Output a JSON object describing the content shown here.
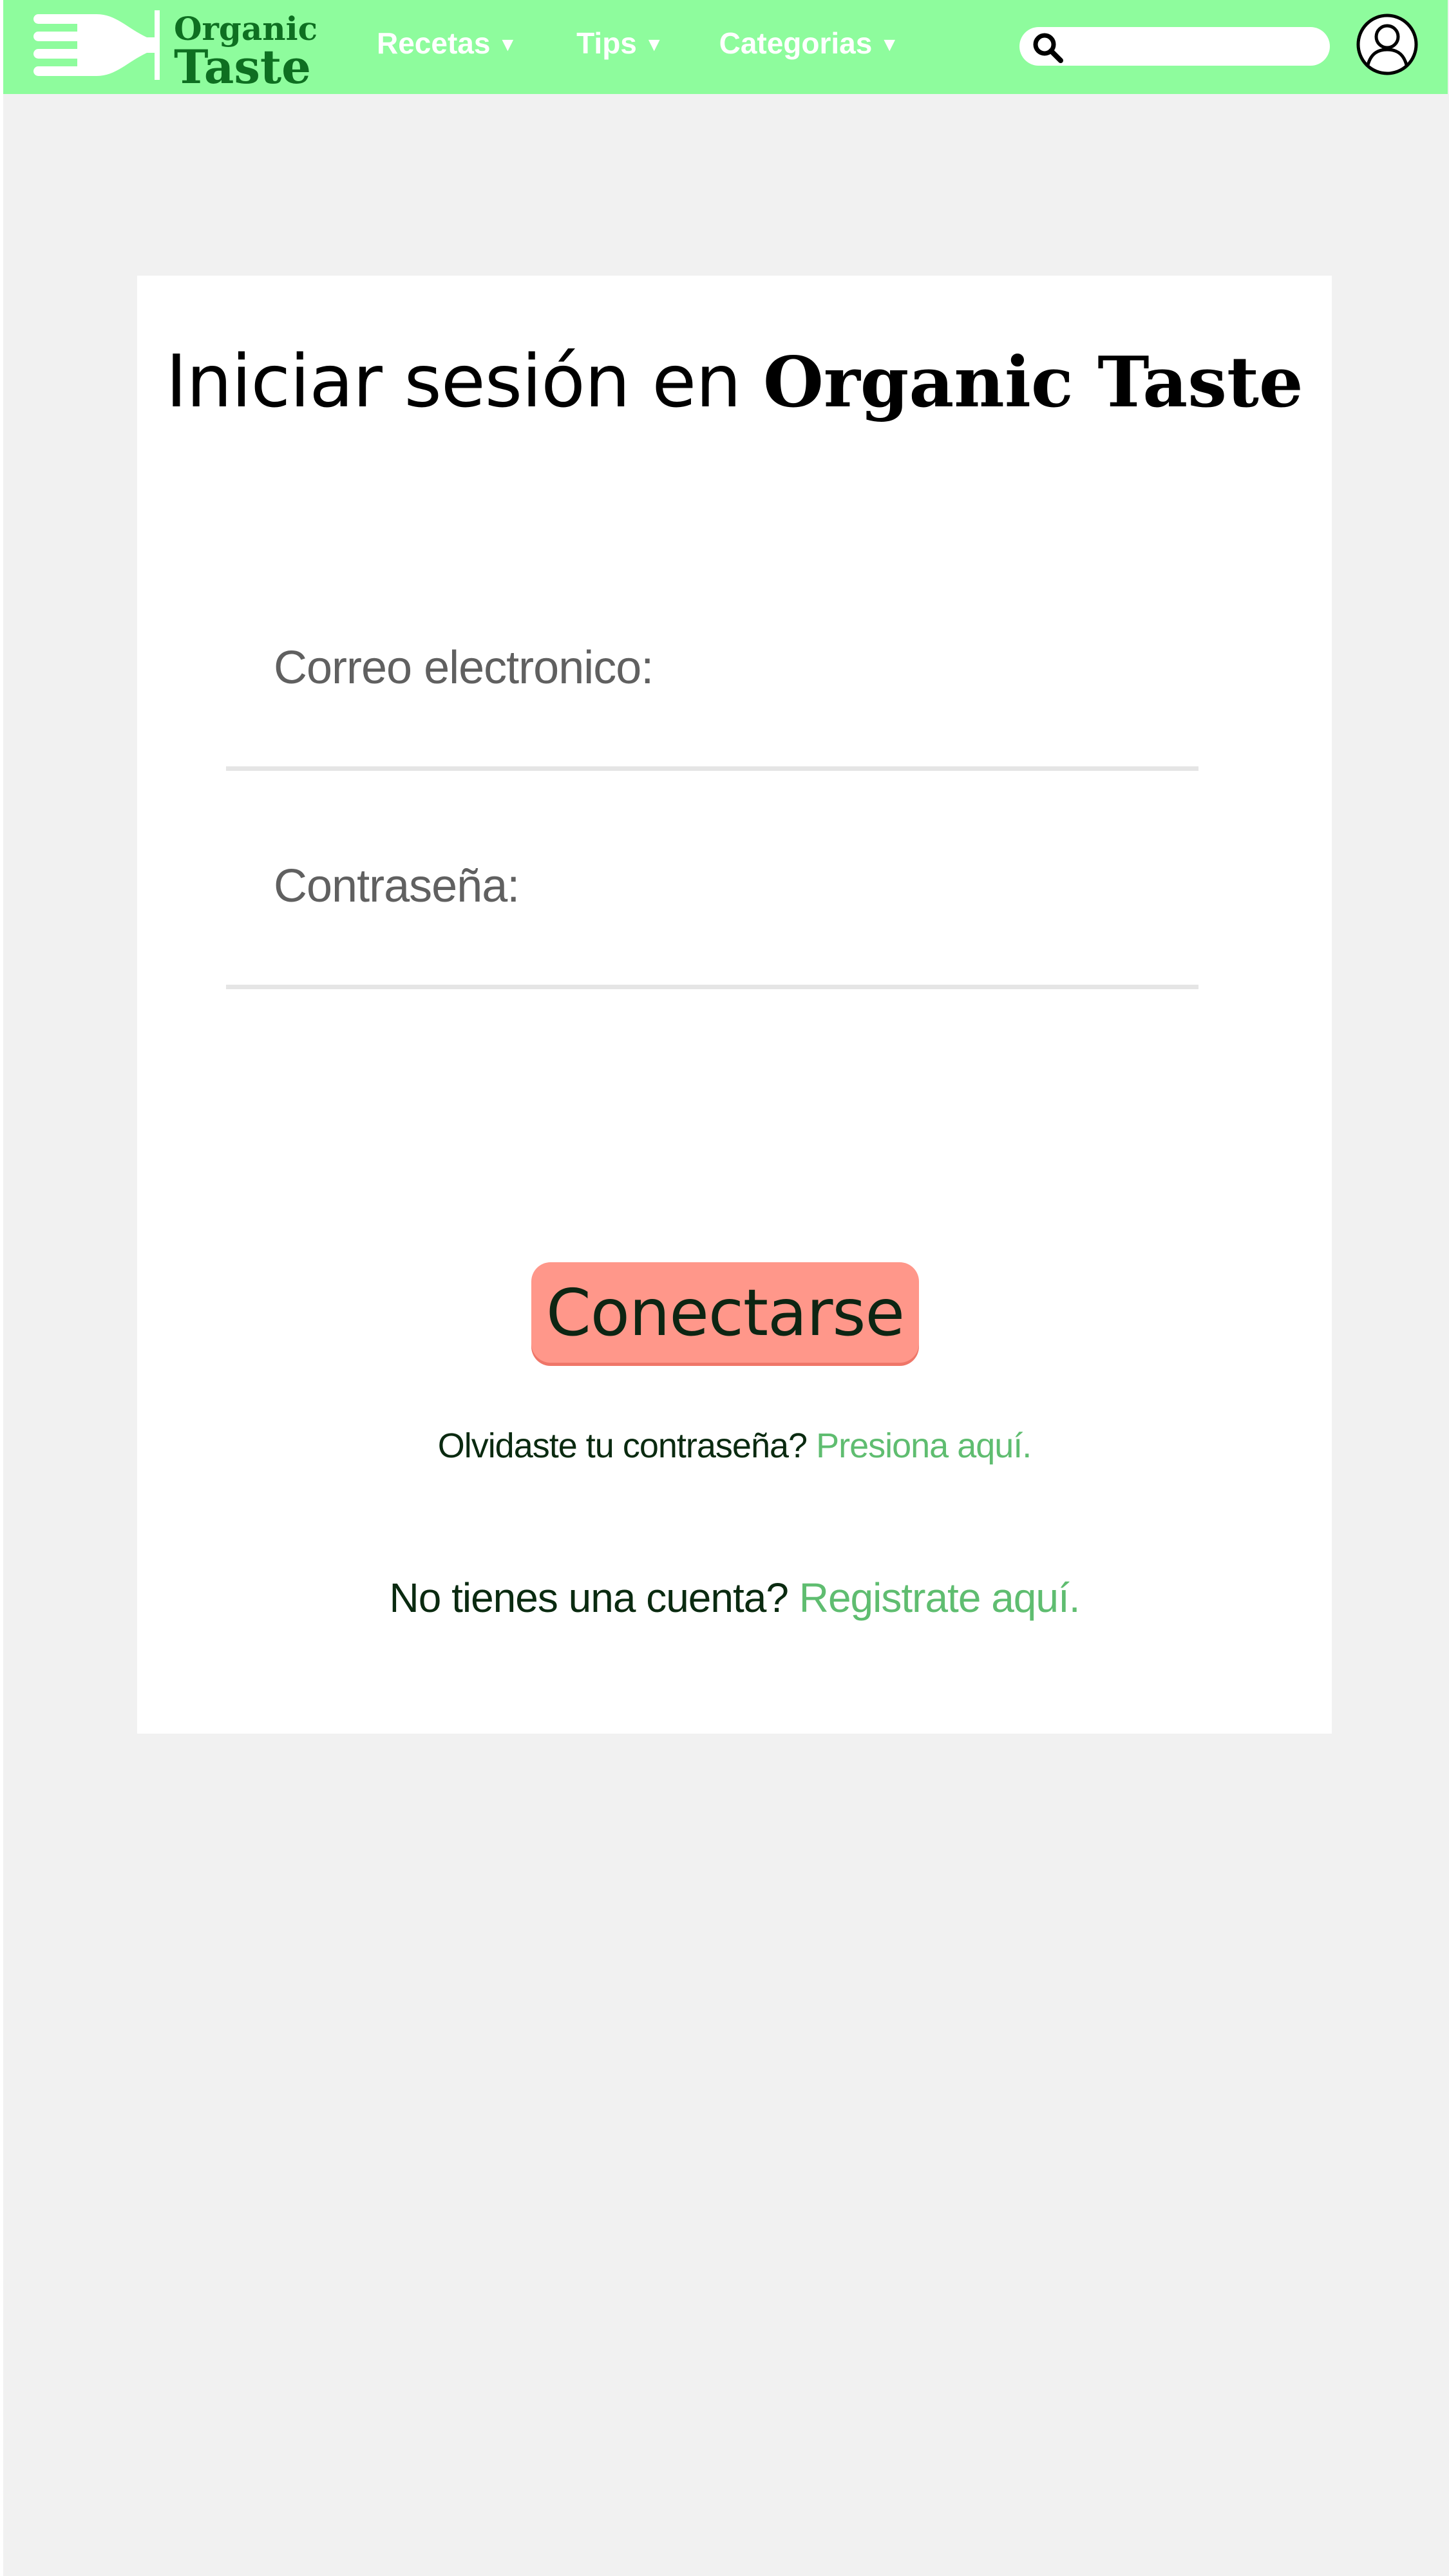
{
  "header": {
    "logo": {
      "line1": "Organic",
      "line2": "Taste"
    },
    "nav": [
      {
        "label": "Recetas",
        "caret": "▼"
      },
      {
        "label": "Tips",
        "caret": "▼"
      },
      {
        "label": "Categorias",
        "caret": "▼"
      }
    ],
    "search": {
      "placeholder": "",
      "value": "",
      "icon": "search-icon"
    },
    "user_icon": "user-account-icon"
  },
  "login": {
    "title_prefix": "Iniciar sesión en",
    "title_brand": "Organic Taste",
    "email_label": "Correo electronico:",
    "email_value": "",
    "password_label": "Contraseña:",
    "password_value": "",
    "submit_label": "Conectarse",
    "forgot_text": "Olvidaste tu contraseña?",
    "forgot_link": "Presiona aquí.",
    "register_text": "No tienes una cuenta?",
    "register_link": "Registrate aquí."
  },
  "colors": {
    "header_bg": "#8efc9d",
    "logo_green": "#0e6f21",
    "page_bg": "#f1f1f1",
    "button_bg": "#ff978a",
    "link_green": "#5fbd70"
  }
}
